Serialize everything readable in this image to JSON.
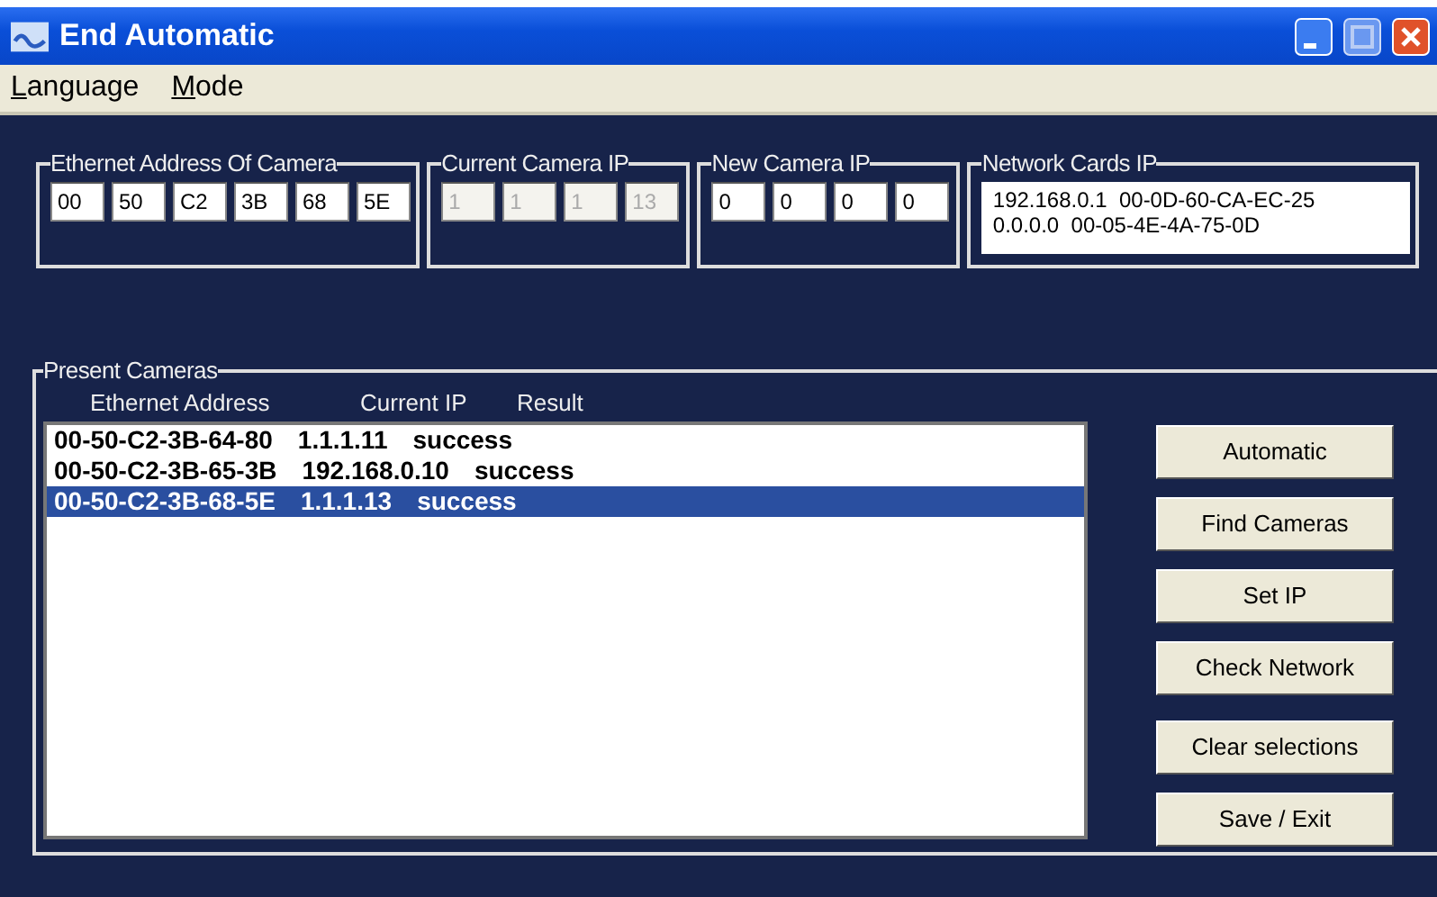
{
  "window": {
    "title": "End Automatic"
  },
  "menu": [
    "Language",
    "Mode"
  ],
  "groups": [
    {
      "title": "Ethernet Address Of Camera",
      "disabled": false,
      "fields": [
        "00",
        "50",
        "C2",
        "3B",
        "68",
        "5E"
      ]
    },
    {
      "title": "Current Camera IP",
      "disabled": true,
      "fields": [
        "1",
        "1",
        "1",
        "13"
      ]
    },
    {
      "title": "New Camera IP",
      "disabled": false,
      "fields": [
        "0",
        "0",
        "0",
        "0"
      ]
    }
  ],
  "network_cards": {
    "title": "Network Cards IP",
    "lines": [
      "192.168.0.1  00-0D-60-CA-EC-25",
      "0.0.0.0  00-05-4E-4A-75-0D"
    ]
  },
  "present_cameras": {
    "title": "Present Cameras",
    "columns": [
      "Ethernet Address",
      "Current IP",
      "Result"
    ],
    "rows": [
      {
        "address": "00-50-C2-3B-64-80",
        "ip": "1.1.1.11",
        "result": "success",
        "selected": false
      },
      {
        "address": "00-50-C2-3B-65-3B",
        "ip": "192.168.0.10",
        "result": "success",
        "selected": false
      },
      {
        "address": "00-50-C2-3B-68-5E",
        "ip": "1.1.1.13",
        "result": "success",
        "selected": true
      }
    ]
  },
  "buttons": [
    "Automatic",
    "Find Cameras",
    "Set IP",
    "Check Network",
    "Clear selections",
    "Save / Exit"
  ]
}
